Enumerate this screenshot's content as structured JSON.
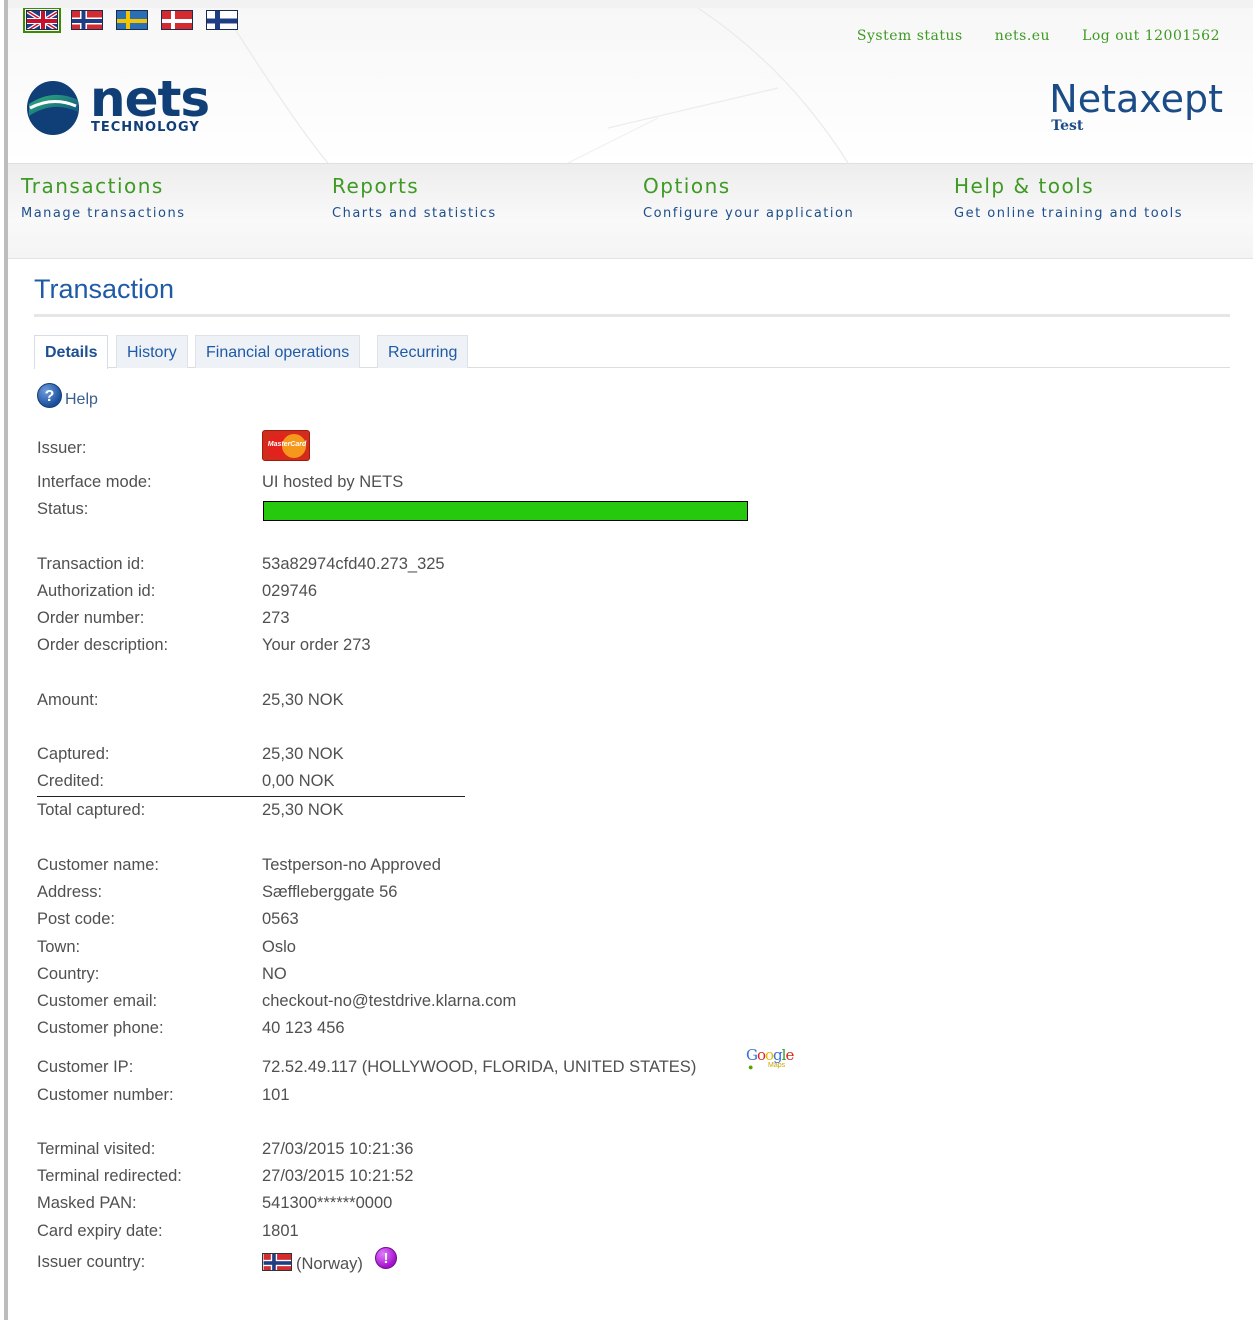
{
  "languages": [
    {
      "code": "en",
      "name": "English",
      "selected": true
    },
    {
      "code": "no",
      "name": "Norwegian",
      "selected": false
    },
    {
      "code": "se",
      "name": "Swedish",
      "selected": false
    },
    {
      "code": "dk",
      "name": "Danish",
      "selected": false
    },
    {
      "code": "fi",
      "name": "Finnish",
      "selected": false
    }
  ],
  "top_links": {
    "system_status": "System status",
    "nets_eu": "nets.eu",
    "logout": "Log out 12001562"
  },
  "logo": {
    "wordmark": "nets",
    "sub": "TECHNOLOGY"
  },
  "product": {
    "name": "Netaxept",
    "env": "Test"
  },
  "nav": [
    {
      "title": "Transactions",
      "subtitle": "Manage transactions"
    },
    {
      "title": "Reports",
      "subtitle": "Charts and statistics"
    },
    {
      "title": "Options",
      "subtitle": "Configure your application"
    },
    {
      "title": "Help & tools",
      "subtitle": "Get online training and tools"
    }
  ],
  "page_title": "Transaction",
  "tabs": [
    {
      "label": "Details",
      "active": true
    },
    {
      "label": "History",
      "active": false
    },
    {
      "label": "Financial operations",
      "active": false
    },
    {
      "label": "Recurring",
      "active": false
    }
  ],
  "help_label": "Help",
  "issuer_card_text": "MasterCard",
  "status_progress": 1.0,
  "details": {
    "issuer": "Issuer:",
    "interface_mode": {
      "label": "Interface mode:",
      "value": "UI hosted by NETS"
    },
    "status": "Status:",
    "transaction_id": {
      "label": "Transaction id:",
      "value": "53a82974cfd40.273_325"
    },
    "authorization_id": {
      "label": "Authorization id:",
      "value": "029746"
    },
    "order_number": {
      "label": "Order number:",
      "value": "273"
    },
    "order_description": {
      "label": "Order description:",
      "value": "Your order 273"
    },
    "amount": {
      "label": "Amount:",
      "value": "25,30 NOK"
    },
    "captured": {
      "label": "Captured:",
      "value": "25,30 NOK"
    },
    "credited": {
      "label": "Credited:",
      "value": "0,00 NOK"
    },
    "total_captured": {
      "label": "Total captured:",
      "value": "25,30 NOK"
    },
    "customer_name": {
      "label": "Customer name:",
      "value": "Testperson-no Approved"
    },
    "address": {
      "label": "Address:",
      "value": "Sæffleberggate 56"
    },
    "post_code": {
      "label": "Post code:",
      "value": "0563"
    },
    "town": {
      "label": "Town:",
      "value": "Oslo"
    },
    "country": {
      "label": "Country:",
      "value": "NO"
    },
    "customer_email": {
      "label": "Customer email:",
      "value": "checkout-no@testdrive.klarna.com"
    },
    "customer_phone": {
      "label": "Customer phone:",
      "value": "40 123 456"
    },
    "customer_ip": {
      "label": "Customer IP:",
      "value": "72.52.49.117 (HOLLYWOOD, FLORIDA, UNITED STATES)"
    },
    "customer_number": {
      "label": "Customer number:",
      "value": "101"
    },
    "terminal_visited": {
      "label": "Terminal visited:",
      "value": "27/03/2015 10:21:36"
    },
    "terminal_redirected": {
      "label": "Terminal redirected:",
      "value": "27/03/2015 10:21:52"
    },
    "masked_pan": {
      "label": "Masked PAN:",
      "value": "541300******0000"
    },
    "card_expiry": {
      "label": "Card expiry date:",
      "value": "1801"
    },
    "issuer_country": {
      "label": "Issuer country:",
      "value": "(Norway)"
    }
  },
  "google_maps": {
    "brand": "Google",
    "sub": "Maps"
  },
  "colors": {
    "brand_green": "#3e9a23",
    "brand_blue": "#103f78",
    "link_blue": "#1f5aa6",
    "status_green": "#27c90e"
  }
}
